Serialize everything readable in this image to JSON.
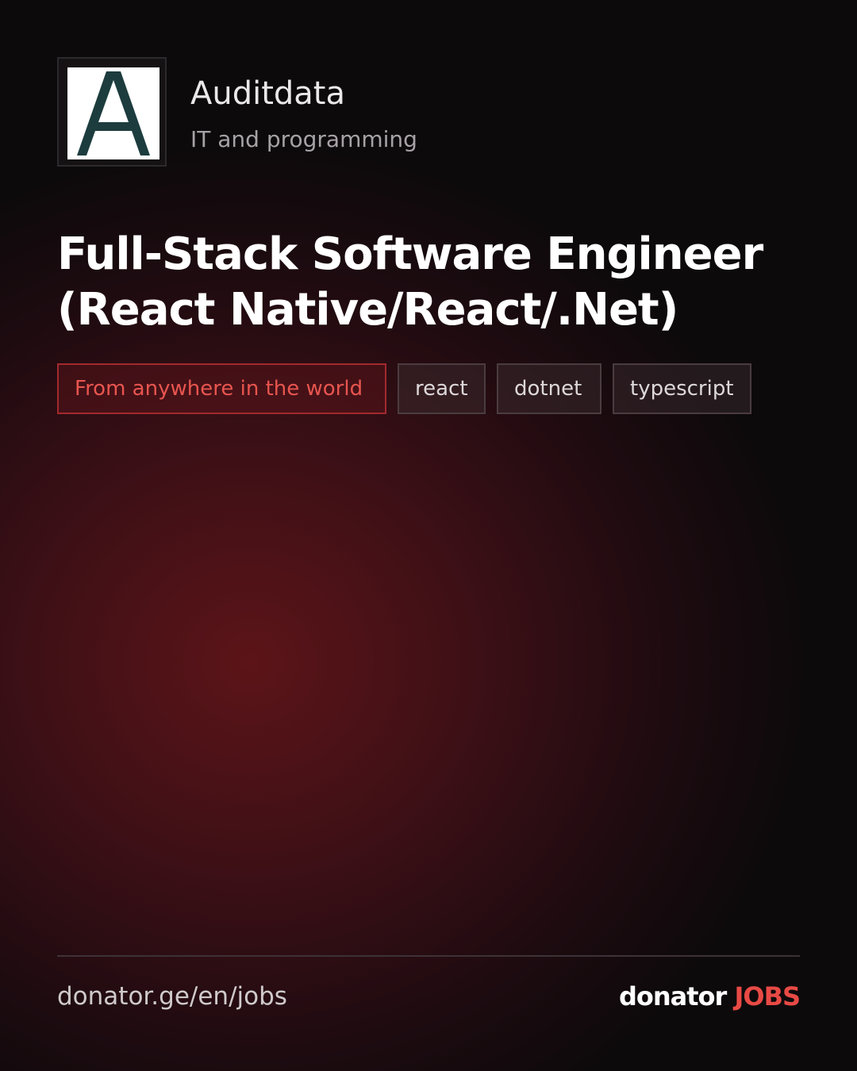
{
  "company": {
    "logo_letter": "A",
    "name": "Auditdata",
    "category": "IT and programming"
  },
  "job": {
    "title_line1": "Full-Stack Software Engineer",
    "title_line2": "(React Native/React/.Net)"
  },
  "tags": {
    "location": "From anywhere in the world",
    "skills": [
      "react",
      "dotnet",
      "typescript"
    ]
  },
  "footer": {
    "url": "donator.ge/en/jobs",
    "brand_word": "donator",
    "brand_jobs": "JOBS"
  },
  "colors": {
    "accent": "#e84a45",
    "logo_letter": "#1d3c3e",
    "background": "#0d0a0c",
    "glow": "#5c1418"
  },
  "icons": {
    "company_logo": "letter-a-logo"
  }
}
